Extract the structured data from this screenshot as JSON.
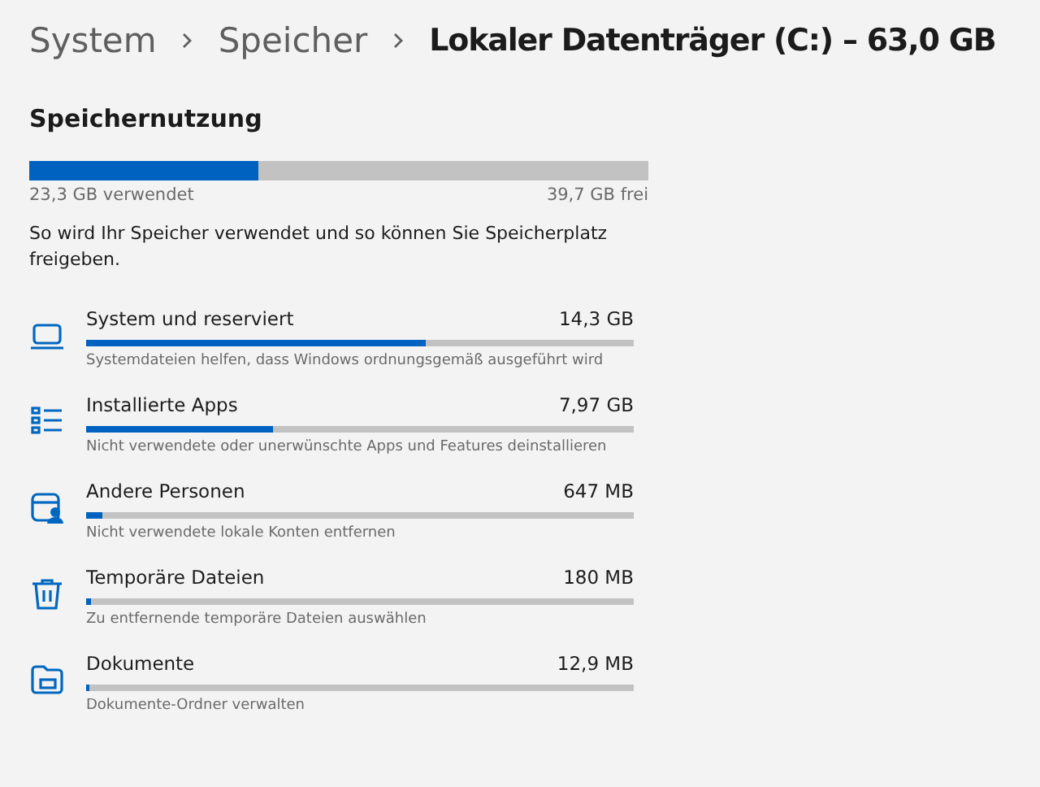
{
  "breadcrumb": [
    {
      "label": "System",
      "current": false
    },
    {
      "label": "Speicher",
      "current": false
    },
    {
      "label": "Lokaler Datenträger (C:) – 63,0 GB",
      "current": true
    }
  ],
  "section_title": "Speichernutzung",
  "usage": {
    "level": 0.37,
    "used": "23,3 GB verwendet",
    "free": "39,7 GB frei"
  },
  "description": "So wird Ihr Speicher verwendet und so können Sie Speicherplatz freigeben.",
  "categories": [
    {
      "kind": "laptop",
      "name": "System und reserviert",
      "size": "14,3 GB",
      "level": 0.62,
      "hint": "Systemdateien helfen, dass Windows ordnungsgemäß ausgeführt wird"
    },
    {
      "kind": "list",
      "name": "Installierte Apps",
      "size": "7,97 GB",
      "level": 0.34,
      "hint": "Nicht verwendete oder unerwünschte Apps und Features deinstallieren"
    },
    {
      "kind": "people",
      "name": "Andere Personen",
      "size": "647 MB",
      "level": 0.03,
      "hint": "Nicht verwendete lokale Konten entfernen"
    },
    {
      "kind": "trash",
      "name": "Temporäre Dateien",
      "size": "180 MB",
      "level": 0.01,
      "hint": "Zu entfernende temporäre Dateien auswählen"
    },
    {
      "kind": "folder",
      "name": "Dokumente",
      "size": "12,9 MB",
      "level": 0.005,
      "hint": "Dokumente-Ordner verwalten"
    }
  ]
}
